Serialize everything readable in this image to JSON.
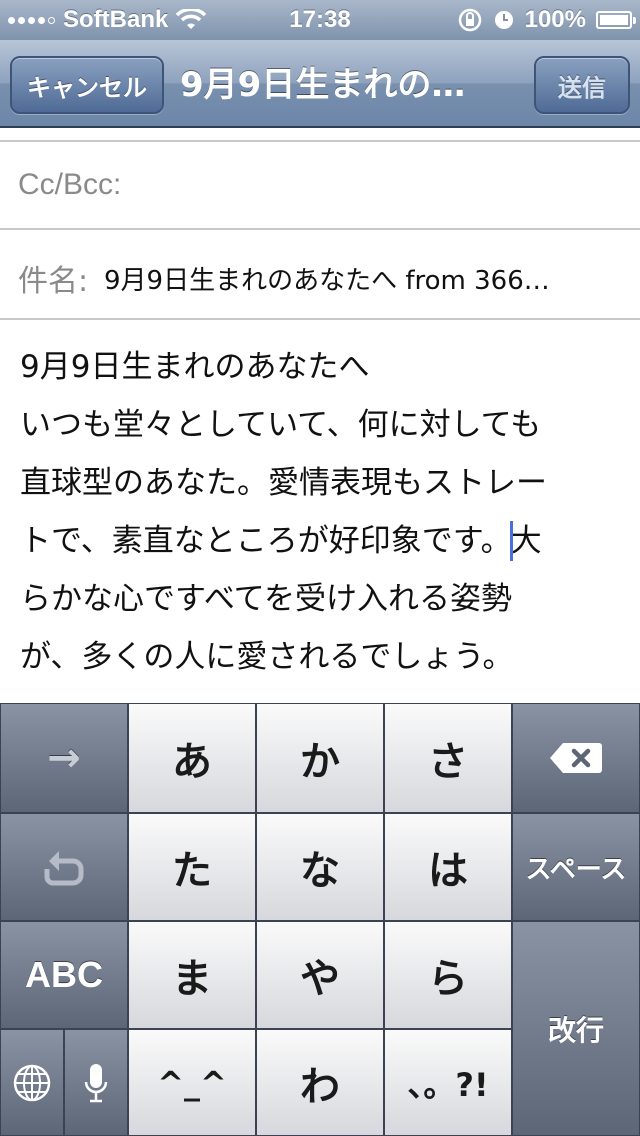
{
  "status_bar": {
    "carrier": "SoftBank",
    "time": "17:38",
    "battery": "100%",
    "battery_level": 1.0
  },
  "nav": {
    "cancel_label": "キャンセル",
    "title": "9月9日生まれの…",
    "send_label": "送信"
  },
  "fields": {
    "cc_label": "Cc/Bcc:",
    "subject_label": "件名:",
    "subject_value": "9月9日生まれのあなたへ from 366…"
  },
  "body": {
    "lines": [
      "9月9日生まれのあなたへ",
      "いつも堂々としていて、何に対しても",
      "直球型のあなた。愛情表現もストレー",
      "トで、素直なところが好印象です。",
      "らかな心ですべてを受け入れる姿勢",
      "が、多くの人に愛されるでしょう。"
    ],
    "after_cursor": "大"
  },
  "keyboard": {
    "arrow": "→",
    "undo": "↺",
    "abc": "ABC",
    "globe": "🌐",
    "mic": "🎤",
    "keys": [
      "あ",
      "か",
      "さ",
      "た",
      "な",
      "は",
      "ま",
      "や",
      "ら",
      "^_^",
      "わ",
      "、。?!"
    ],
    "delete": "⌫",
    "space": "スペース",
    "return": "改行"
  }
}
